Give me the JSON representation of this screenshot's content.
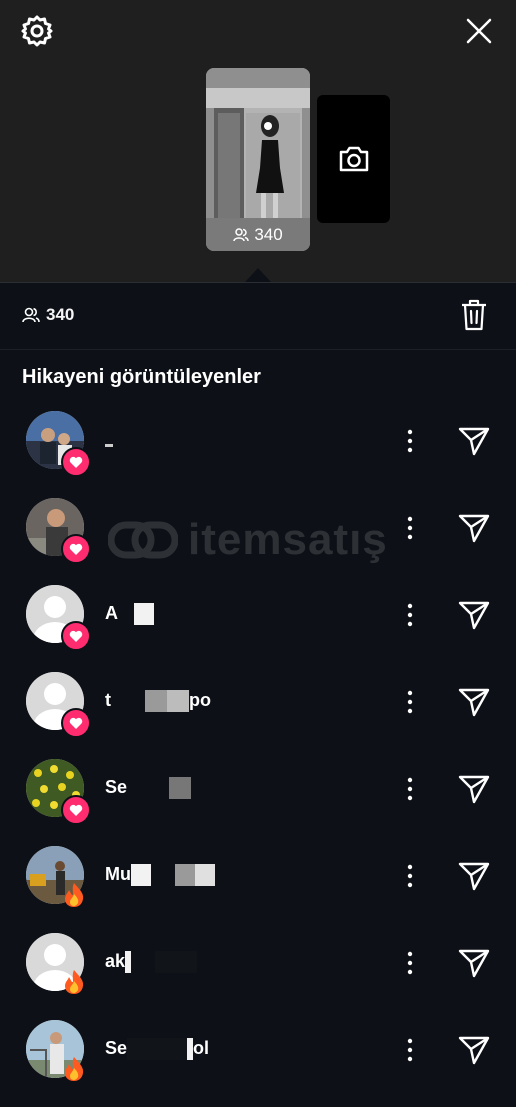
{
  "header": {
    "thumbnail_count": "340"
  },
  "stats": {
    "viewer_count": "340"
  },
  "section_title": "Hikayeni görüntüleyenler",
  "watermark": "itemsatış",
  "viewers": [
    {
      "name": "",
      "reaction": "heart"
    },
    {
      "name": "",
      "reaction": "heart"
    },
    {
      "name": "A",
      "reaction": "heart"
    },
    {
      "name": "t",
      "name_suffix": "po",
      "reaction": "heart"
    },
    {
      "name": "Se",
      "reaction": "heart"
    },
    {
      "name": "Mu",
      "reaction": "fire"
    },
    {
      "name": "ak",
      "reaction": "fire"
    },
    {
      "name": "Se",
      "name_suffix": "ol",
      "reaction": "fire"
    }
  ],
  "colors": {
    "background": "#0d1117",
    "top_panel": "#1f1f1f",
    "heart_badge": "#ff2d6f"
  },
  "icons": {
    "settings": "gear-icon",
    "close": "close-icon",
    "camera": "camera-icon",
    "viewers": "people-icon",
    "delete": "trash-icon",
    "more": "more-vertical-icon",
    "send": "send-icon"
  }
}
